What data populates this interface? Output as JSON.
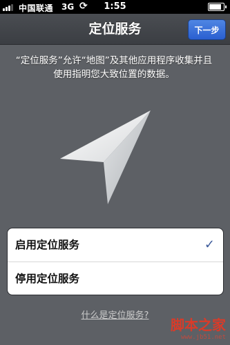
{
  "status_bar": {
    "carrier": "中国联通",
    "network": "3G",
    "sync_icon": "sync-icon",
    "time": "1:55",
    "battery_level": 0.85
  },
  "nav": {
    "title": "定位服务",
    "next_label": "下一步"
  },
  "description": "“定位服务”允许“地图”及其他应用程序收集并且使用指明您大致位置的数据。",
  "arrow_icon": "location-arrow-icon",
  "options": [
    {
      "label": "启用定位服务",
      "selected": true
    },
    {
      "label": "停用定位服务",
      "selected": false
    }
  ],
  "checkmark": "✓",
  "help_link": "什么是定位服务?",
  "watermark": {
    "brand": "脚本之家",
    "url": "www.jb51.net"
  },
  "colors": {
    "background": "#5d6065",
    "nav_button": "#2a5fd0",
    "checkmark": "#3c5a9a"
  }
}
